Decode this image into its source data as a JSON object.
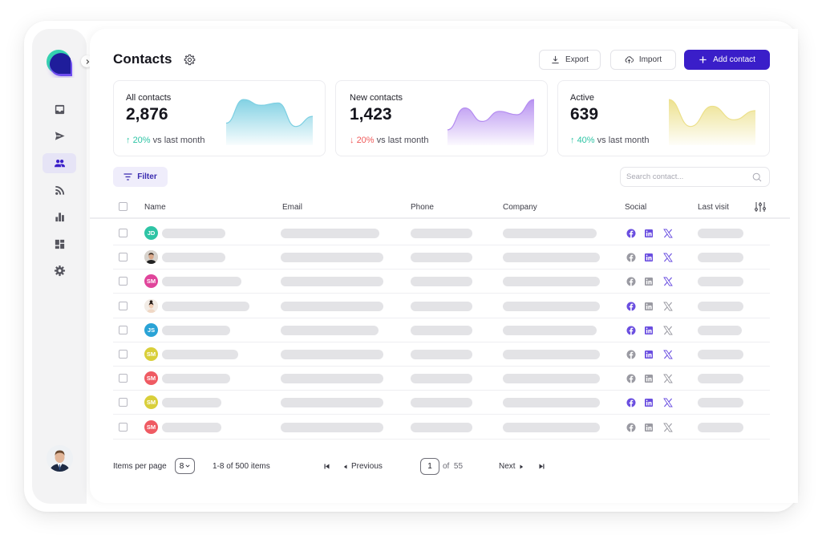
{
  "app": {
    "page_title": "Contacts",
    "colors": {
      "brand": "#3a1ec9",
      "up": "#2ec4a5",
      "down": "#ef5a5a",
      "social_active": "#6a4ee0",
      "social_inactive": "#9a9aa2"
    }
  },
  "sidebar": {
    "logo": "app-logo",
    "collapse_icon": "chevron-right-icon",
    "items": [
      {
        "name": "inbox",
        "icon": "inbox-icon",
        "active": false
      },
      {
        "name": "send",
        "icon": "send-icon",
        "active": false
      },
      {
        "name": "contacts",
        "icon": "users-icon",
        "active": true
      },
      {
        "name": "feeds",
        "icon": "rss-icon",
        "active": false
      },
      {
        "name": "analytics",
        "icon": "bar-chart-icon",
        "active": false
      },
      {
        "name": "dashboard",
        "icon": "dashboard-icon",
        "active": false
      },
      {
        "name": "settings",
        "icon": "gear-icon",
        "active": false
      }
    ],
    "user_avatar": "user-photo"
  },
  "toolbar": {
    "export_label": "Export",
    "import_label": "Import",
    "add_label": "Add contact"
  },
  "stats": [
    {
      "label": "All contacts",
      "value": "2,876",
      "change": "20%",
      "direction": "up",
      "suffix": "vs last month",
      "color": "#7ccfe2",
      "trend": [
        0.25,
        0.95,
        0.78,
        0.85,
        0.15,
        0.45
      ]
    },
    {
      "label": "New contacts",
      "value": "1,423",
      "change": "20%",
      "direction": "down",
      "suffix": "vs last month",
      "color": "#b48cf0",
      "trend": [
        0.05,
        0.7,
        0.3,
        0.6,
        0.5,
        0.95
      ]
    },
    {
      "label": "Active",
      "value": "639",
      "change": "40%",
      "direction": "up",
      "suffix": "vs last month",
      "color": "#ece08a",
      "trend": [
        0.95,
        0.15,
        0.75,
        0.35,
        0.62
      ]
    }
  ],
  "filter": {
    "label": "Filter"
  },
  "search": {
    "placeholder": "Search contact..."
  },
  "table": {
    "columns": [
      "Name",
      "Email",
      "Phone",
      "Company",
      "Social",
      "Last visit"
    ],
    "rows": [
      {
        "initials": "JD",
        "avatar_color": "#2ec4a5",
        "photo": false,
        "social": [
          true,
          true,
          true
        ]
      },
      {
        "initials": "",
        "avatar_color": "#cfc8c0",
        "photo": true,
        "social": [
          false,
          true,
          true
        ]
      },
      {
        "initials": "SM",
        "avatar_color": "#e0459b",
        "photo": false,
        "social": [
          false,
          false,
          true
        ]
      },
      {
        "initials": "",
        "avatar_color": "#efe2d8",
        "photo": true,
        "social": [
          true,
          false,
          false
        ]
      },
      {
        "initials": "JS",
        "avatar_color": "#2aa3d6",
        "photo": false,
        "social": [
          true,
          true,
          false
        ]
      },
      {
        "initials": "SM",
        "avatar_color": "#d9cf3a",
        "photo": false,
        "social": [
          false,
          true,
          true
        ]
      },
      {
        "initials": "SM",
        "avatar_color": "#ef5b63",
        "photo": false,
        "social": [
          false,
          false,
          false
        ]
      },
      {
        "initials": "SM",
        "avatar_color": "#d9cf3a",
        "photo": false,
        "social": [
          true,
          true,
          true
        ]
      },
      {
        "initials": "SM",
        "avatar_color": "#ef5b63",
        "photo": false,
        "social": [
          false,
          false,
          false
        ]
      }
    ]
  },
  "pagination": {
    "items_per_page_label": "Items per page",
    "items_per_page": "8",
    "range_label": "1-8 of 500 items",
    "previous_label": "Previous",
    "next_label": "Next",
    "current_page": "1",
    "of_label": "of",
    "total_pages": "55"
  }
}
